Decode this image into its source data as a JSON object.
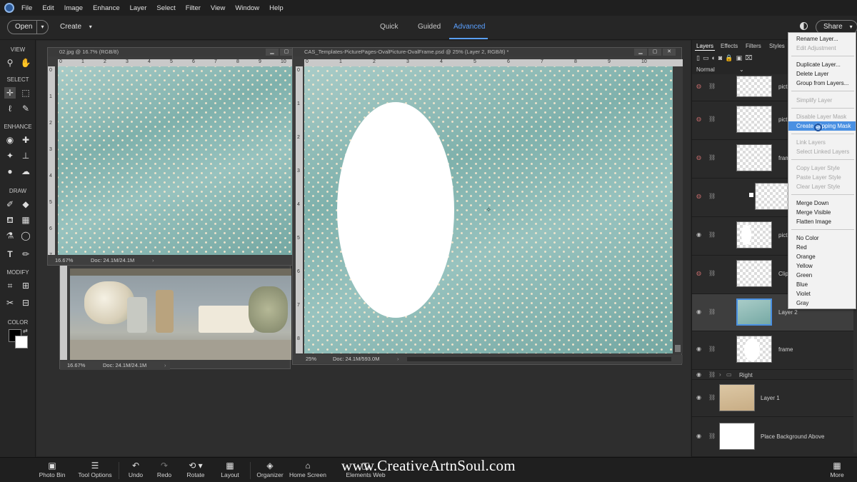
{
  "menubar": {
    "items": [
      "File",
      "Edit",
      "Image",
      "Enhance",
      "Layer",
      "Select",
      "Filter",
      "View",
      "Window",
      "Help"
    ]
  },
  "topbar": {
    "open_label": "Open",
    "create_label": "Create",
    "modes": [
      "Quick",
      "Guided",
      "Advanced"
    ],
    "active_mode": "Advanced",
    "share_label": "Share"
  },
  "toolbox": {
    "sections": [
      "VIEW",
      "SELECT",
      "ENHANCE",
      "DRAW",
      "MODIFY",
      "COLOR"
    ]
  },
  "docs": {
    "doc1": {
      "title": "02.jpg @ 16.7% (RGB/8)",
      "zoom": "16.67%",
      "docsize": "Doc: 24.1M/24.1M"
    },
    "doc2": {
      "zoom": "16.67%",
      "docsize": "Doc: 24.1M/24.1M"
    },
    "doc3": {
      "title": "CAS_Templates-PicturePages-OvalPicture-OvalFrame.psd @ 25% (Layer 2, RGB/8) *",
      "zoom": "25%",
      "docsize": "Doc: 24.1M/593.0M"
    },
    "ruler_h_small": [
      "0",
      "1",
      "2",
      "3",
      "4",
      "5",
      "6",
      "7",
      "8",
      "9",
      "10"
    ],
    "ruler_v_small": [
      "0",
      "1",
      "2",
      "3",
      "4",
      "5",
      "6",
      "7"
    ],
    "ruler_h_big": [
      "0",
      "1",
      "2",
      "3",
      "4",
      "5",
      "6",
      "7",
      "8",
      "9",
      "10"
    ],
    "ruler_v_big": [
      "0",
      "1",
      "2",
      "3",
      "4",
      "5",
      "6",
      "7",
      "8"
    ]
  },
  "layers_panel": {
    "tabs": [
      "Layers",
      "Effects",
      "Filters",
      "Styles"
    ],
    "blend_mode": "Normal",
    "rows": [
      {
        "name": "pict"
      },
      {
        "name": "pict"
      },
      {
        "name": "fram"
      },
      {
        "name": ""
      },
      {
        "name": "pict"
      },
      {
        "name": "Clip"
      },
      {
        "name": "Layer 2"
      },
      {
        "name": "frame"
      },
      {
        "name": "Right"
      },
      {
        "name": "Layer 1"
      },
      {
        "name": "Place Background Above"
      }
    ]
  },
  "context_menu": {
    "items": [
      {
        "label": "Rename Layer...",
        "disabled": false
      },
      {
        "label": "Edit Adjustment",
        "disabled": true
      },
      {
        "label": "Duplicate Layer...",
        "disabled": false
      },
      {
        "label": "Delete Layer",
        "disabled": false
      },
      {
        "label": "Group from Layers...",
        "disabled": false
      },
      {
        "label": "Simplify Layer",
        "disabled": true
      },
      {
        "label": "Disable Layer Mask",
        "disabled": true
      },
      {
        "label": "Create Clipping Mask",
        "disabled": false,
        "highlighted": true
      },
      {
        "label": "Link Layers",
        "disabled": true
      },
      {
        "label": "Select Linked Layers",
        "disabled": true
      },
      {
        "label": "Copy Layer Style",
        "disabled": true
      },
      {
        "label": "Paste Layer Style",
        "disabled": true
      },
      {
        "label": "Clear Layer Style",
        "disabled": true
      },
      {
        "label": "Merge Down",
        "disabled": false
      },
      {
        "label": "Merge Visible",
        "disabled": false
      },
      {
        "label": "Flatten Image",
        "disabled": false
      },
      {
        "label": "No Color",
        "disabled": false
      },
      {
        "label": "Red",
        "disabled": false
      },
      {
        "label": "Orange",
        "disabled": false
      },
      {
        "label": "Yellow",
        "disabled": false
      },
      {
        "label": "Green",
        "disabled": false
      },
      {
        "label": "Blue",
        "disabled": false
      },
      {
        "label": "Violet",
        "disabled": false
      },
      {
        "label": "Gray",
        "disabled": false
      }
    ]
  },
  "bottombar": {
    "items": [
      "Photo Bin",
      "Tool Options",
      "Undo",
      "Redo",
      "Rotate",
      "Layout",
      "Organizer",
      "Home Screen",
      "Elements Web",
      "More"
    ]
  },
  "watermark": "www.CreativeArtnSoul.com",
  "colors": {
    "accent": "#5aa0ff",
    "menu_highlight": "#4a90e2",
    "pattern_base": "#8fbcb8",
    "pattern_dot": "#f0e4cc"
  }
}
